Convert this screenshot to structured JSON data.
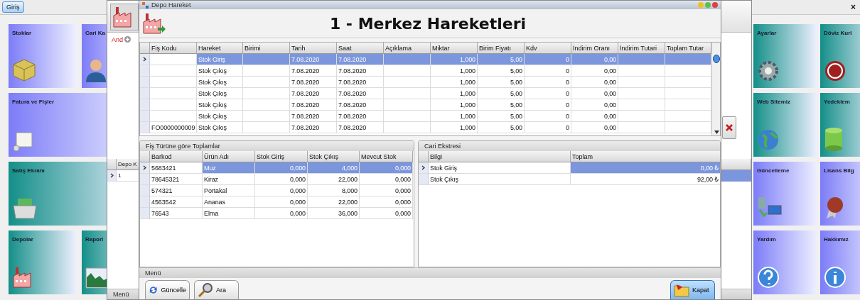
{
  "app": {
    "tab": {
      "label": "Giriş",
      "selected": true
    },
    "close": "×",
    "left_tiles": [
      {
        "label": "Stoklar",
        "kind": "small",
        "color": "#7c7cf8"
      },
      {
        "label": "Cari Ka",
        "kind": "small",
        "color": "#7c7cf8"
      },
      {
        "label": "Fatura ve Fişler",
        "kind": "wide",
        "color": "#7c7cf8"
      },
      {
        "label": "Satış Ekranı",
        "kind": "wide",
        "color": "#138f88"
      },
      {
        "label": "Depolar",
        "kind": "small",
        "color": "#138f88"
      },
      {
        "label": "Raporl",
        "kind": "small",
        "color": "#138f88"
      }
    ],
    "right_tiles": [
      {
        "label": "Ayarlar",
        "color": "#138f88"
      },
      {
        "label": "Döviz Kurl",
        "color": "#138f88"
      },
      {
        "label": "Web Sitemiz",
        "color": "#138f88"
      },
      {
        "label": "Yedeklem",
        "color": "#138f88"
      },
      {
        "label": "Güncelleme",
        "color": "#7c7cf8"
      },
      {
        "label": "Lisans Bilg",
        "color": "#7c7cf8"
      },
      {
        "label": "Yardım",
        "color": "#7c7cf8"
      },
      {
        "label": "Hakkımız",
        "color": "#7c7cf8"
      }
    ]
  },
  "back_window": {
    "filter": {
      "operator": "And"
    },
    "grid": {
      "columns": [
        "Depo K"
      ],
      "rows": [
        {
          "selected": true,
          "cells": [
            "1"
          ]
        }
      ]
    },
    "menu": "Menü"
  },
  "window": {
    "title": "Depo Hareket",
    "heading": "1 - Merkez Hareketleri",
    "grid": {
      "columns": [
        "Fiş Kodu",
        "Hareket",
        "Birimi",
        "Tarih",
        "Saat",
        "Açıklama",
        "Miktar",
        "Birim Fiyatı",
        "Kdv",
        "İndirim Oranı",
        "İndirim Tutari",
        "Toplam Tutar"
      ],
      "rows": [
        {
          "selected": true,
          "cells": [
            null,
            "Stok Giriş",
            null,
            "7.08.2020",
            "7.08.2020",
            null,
            "1,000",
            "5,00",
            "0",
            "0,00",
            null,
            null
          ]
        },
        {
          "selected": false,
          "cells": [
            null,
            "Stok Çıkış",
            null,
            "7.08.2020",
            "7.08.2020",
            null,
            "1,000",
            "5,00",
            "0",
            "0,00",
            null,
            null
          ]
        },
        {
          "selected": false,
          "cells": [
            null,
            "Stok Çıkış",
            null,
            "7.08.2020",
            "7.08.2020",
            null,
            "1,000",
            "5,00",
            "0",
            "0,00",
            null,
            null
          ]
        },
        {
          "selected": false,
          "cells": [
            null,
            "Stok Çıkış",
            null,
            "7.08.2020",
            "7.08.2020",
            null,
            "1,000",
            "5,00",
            "0",
            "0,00",
            null,
            null
          ]
        },
        {
          "selected": false,
          "cells": [
            null,
            "Stok Çıkış",
            null,
            "7.08.2020",
            "7.08.2020",
            null,
            "1,000",
            "5,00",
            "0",
            "0,00",
            null,
            null
          ]
        },
        {
          "selected": false,
          "cells": [
            null,
            "Stok Çıkış",
            null,
            "7.08.2020",
            "7.08.2020",
            null,
            "1,000",
            "5,00",
            "0",
            "0,00",
            null,
            null
          ]
        },
        {
          "selected": false,
          "cells": [
            "FO0000000009",
            "Stok Çıkış",
            null,
            "7.08.2020",
            "7.08.2020",
            null,
            "1,000",
            "5,00",
            "0",
            "0,00",
            null,
            null
          ]
        }
      ]
    },
    "panels": [
      {
        "title": "Fiş Türüne göre Toplamlar",
        "grid": {
          "columns": [
            "Barkod",
            "Ürün Adı",
            "Stok Giriş",
            "Stok Çıkış",
            "Mevcut Stok"
          ],
          "rows": [
            {
              "selected": true,
              "cells": [
                "5683421",
                "Muz",
                "0,000",
                "4,000",
                "0,000"
              ]
            },
            {
              "selected": false,
              "cells": [
                "78645321",
                "Kiraz",
                "0,000",
                "22,000",
                "0,000"
              ]
            },
            {
              "selected": false,
              "cells": [
                "574321",
                "Portakal",
                "0,000",
                "8,000",
                "0,000"
              ]
            },
            {
              "selected": false,
              "cells": [
                "4563542",
                "Ananas",
                "0,000",
                "22,000",
                "0,000"
              ]
            },
            {
              "selected": false,
              "cells": [
                "76543",
                "Elma",
                "0,000",
                "36,000",
                "0,000"
              ]
            }
          ]
        }
      },
      {
        "title": "Cari Ekstresi",
        "grid": {
          "columns": [
            "Bilgi",
            "Toplam"
          ],
          "rows": [
            {
              "selected": true,
              "cells": [
                "Stok Giriş",
                "0,00 ₺"
              ]
            },
            {
              "selected": false,
              "cells": [
                "Stok Çıkış",
                "92,00 ₺"
              ]
            }
          ]
        }
      }
    ],
    "menu": "Menü",
    "buttons": [
      {
        "label": "Güncelle",
        "focused": false
      },
      {
        "label": "Ara",
        "focused": false
      },
      {
        "label": "Kapat",
        "focused": true
      }
    ]
  }
}
